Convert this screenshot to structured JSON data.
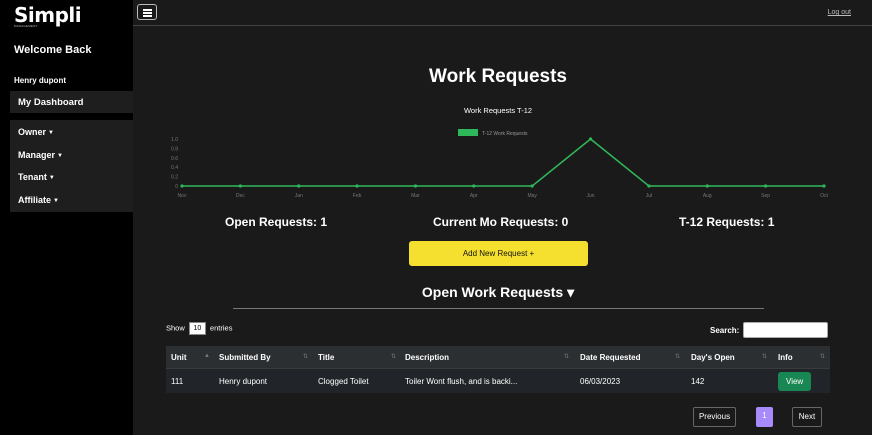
{
  "brand": {
    "name": "Simpli",
    "sub": "MANAGEMENT"
  },
  "sidebar": {
    "welcome": "Welcome Back",
    "user": "Henry dupont",
    "dashboard": "My Dashboard",
    "menu": [
      "Owner",
      "Manager",
      "Tenant",
      "Affiliate"
    ]
  },
  "topbar": {
    "logout": "Log out"
  },
  "page": {
    "title": "Work Requests"
  },
  "chart_data": {
    "type": "line",
    "title": "Work Requests T-12",
    "legend": "T-12 Work Requests",
    "legend_position": "top-center",
    "categories": [
      "Nov",
      "Dec",
      "Jan",
      "Feb",
      "Mar",
      "Apr",
      "May",
      "Jun",
      "Jul",
      "Aug",
      "Sep",
      "Oct"
    ],
    "series": [
      {
        "name": "T-12 Work Requests",
        "values": [
          0,
          0,
          0,
          0,
          0,
          0,
          0,
          1,
          0,
          0,
          0,
          0
        ]
      }
    ],
    "y_ticks": [
      "0",
      "0.2",
      "0.4",
      "0.6",
      "0.8",
      "1.0"
    ],
    "ylim": [
      0,
      1
    ],
    "grid": false,
    "color": "#2fb85a"
  },
  "stats": {
    "open": "Open Requests: 1",
    "current": "Current Mo Requests: 0",
    "t12": "T-12 Requests: 1"
  },
  "add_button": "Add New Request +",
  "open_title": "Open Work Requests ▾",
  "table_controls": {
    "show": "Show",
    "entries_value": "10",
    "entries": "entries",
    "search": "Search:"
  },
  "table": {
    "headers": [
      "Unit",
      "Submitted By",
      "Title",
      "Description",
      "Date Requested",
      "Day's Open",
      "Info"
    ],
    "rows": [
      {
        "unit": "111",
        "submitted_by": "Henry dupont",
        "title": "Clogged Toilet",
        "description": "Toiler Wont flush, and is backi...",
        "date": "06/03/2023",
        "days_open": "142",
        "action": "View"
      }
    ]
  },
  "pagination": {
    "previous": "Previous",
    "page": "1",
    "next": "Next",
    "active_color": "#a78bfa"
  }
}
